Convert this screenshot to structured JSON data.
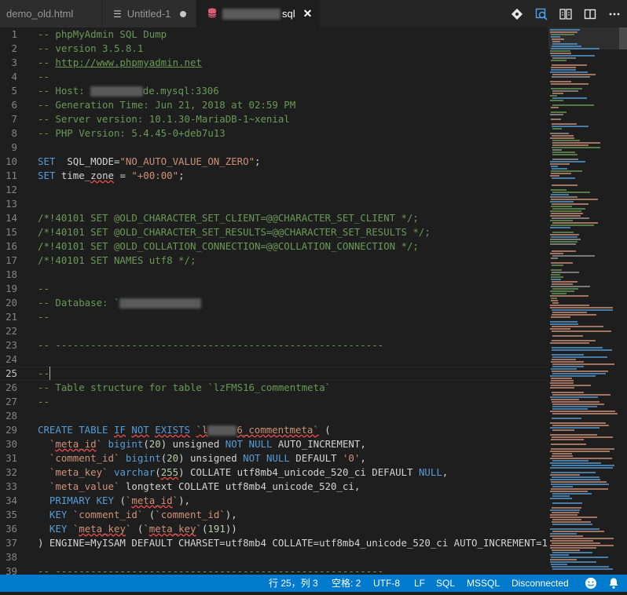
{
  "tabs": [
    {
      "label": "demo_old.html",
      "state": "inactive"
    },
    {
      "label": "Untitled-1",
      "state": "inactive",
      "icon": "menu-lines-icon",
      "dirty": true
    },
    {
      "label": "sql",
      "state": "active",
      "icon": "database-icon",
      "close": "✕"
    }
  ],
  "actions": [
    "git-commit-icon",
    "open-changes-icon",
    "compare-icon",
    "split-editor-icon",
    "more-actions-icon"
  ],
  "lines": [
    {
      "n": "1",
      "t": [
        [
          "cm",
          "-- phpMyAdmin SQL Dump"
        ]
      ]
    },
    {
      "n": "2",
      "t": [
        [
          "cm",
          "-- version 3.5.8.1"
        ]
      ]
    },
    {
      "n": "3",
      "t": [
        [
          "cm",
          "-- "
        ],
        [
          "cm ul",
          "http://www.phpmyadmin.net"
        ]
      ]
    },
    {
      "n": "4",
      "t": [
        [
          "cm",
          "--"
        ]
      ]
    },
    {
      "n": "5",
      "t": [
        [
          "cm",
          "-- Host: "
        ],
        [
          "blur",
          "         "
        ],
        [
          "cm",
          "de.mysql:3306"
        ]
      ]
    },
    {
      "n": "6",
      "t": [
        [
          "cm",
          "-- Generation Time: Jun 21, 2018 at 02:59 PM"
        ]
      ]
    },
    {
      "n": "7",
      "t": [
        [
          "cm",
          "-- Server version: 10.1.30-MariaDB-1~xenial"
        ]
      ]
    },
    {
      "n": "8",
      "t": [
        [
          "cm",
          "-- PHP Version: 5.4.45-0+deb7u13"
        ]
      ]
    },
    {
      "n": "9",
      "t": []
    },
    {
      "n": "10",
      "t": [
        [
          "kw",
          "SET"
        ],
        [
          "",
          "  SQL_MODE="
        ],
        [
          "st",
          "\"NO_AUTO_VALUE_ON_ZERO\""
        ],
        [
          "",
          ";"
        ]
      ]
    },
    {
      "n": "11",
      "t": [
        [
          "kw",
          "SET"
        ],
        [
          "",
          " time_"
        ],
        [
          "sq",
          "zone"
        ],
        [
          "",
          " = "
        ],
        [
          "st",
          "\"+00:00\""
        ],
        [
          "",
          ";"
        ]
      ]
    },
    {
      "n": "12",
      "t": []
    },
    {
      "n": "13",
      "t": []
    },
    {
      "n": "14",
      "t": [
        [
          "cm",
          "/*!40101 SET @OLD_CHARACTER_SET_CLIENT=@@CHARACTER_SET_CLIENT */;"
        ]
      ]
    },
    {
      "n": "15",
      "t": [
        [
          "cm",
          "/*!40101 SET @OLD_CHARACTER_SET_RESULTS=@@CHARACTER_SET_RESULTS */;"
        ]
      ]
    },
    {
      "n": "16",
      "t": [
        [
          "cm",
          "/*!40101 SET @OLD_COLLATION_CONNECTION=@@COLLATION_CONNECTION */;"
        ]
      ]
    },
    {
      "n": "17",
      "t": [
        [
          "cm",
          "/*!40101 SET NAMES utf8 */;"
        ]
      ]
    },
    {
      "n": "18",
      "t": []
    },
    {
      "n": "19",
      "t": [
        [
          "cm",
          "--"
        ]
      ]
    },
    {
      "n": "20",
      "t": [
        [
          "cm",
          "-- Database: `"
        ],
        [
          "blur",
          "              "
        ]
      ]
    },
    {
      "n": "21",
      "t": [
        [
          "cm",
          "--"
        ]
      ]
    },
    {
      "n": "22",
      "t": []
    },
    {
      "n": "23",
      "t": [
        [
          "cm",
          "-- --------------------------------------------------------"
        ]
      ]
    },
    {
      "n": "24",
      "t": []
    },
    {
      "n": "25",
      "t": [
        [
          "cm",
          "--"
        ],
        [
          "cursor",
          ""
        ]
      ],
      "current": true
    },
    {
      "n": "26",
      "t": [
        [
          "cm",
          "-- Table structure for table `lzFMS16_commentmeta`"
        ]
      ]
    },
    {
      "n": "27",
      "t": [
        [
          "cm",
          "--"
        ]
      ]
    },
    {
      "n": "28",
      "t": []
    },
    {
      "n": "29",
      "t": [
        [
          "kw",
          "CREATE TABLE"
        ],
        [
          "",
          " "
        ],
        [
          "kw sq",
          "IF"
        ],
        [
          "",
          " "
        ],
        [
          "kw sq",
          "NOT"
        ],
        [
          "",
          " "
        ],
        [
          "kw sq",
          "EXISTS"
        ],
        [
          "",
          " "
        ],
        [
          "st sq",
          "`l"
        ],
        [
          "blur",
          "     "
        ],
        [
          "st sq",
          "6_commentmeta`"
        ],
        [
          "",
          " ("
        ]
      ]
    },
    {
      "n": "30",
      "t": [
        [
          "",
          "  "
        ],
        [
          "st",
          "`"
        ],
        [
          "st sq",
          "meta_id"
        ],
        [
          "st",
          "`"
        ],
        [
          "",
          " "
        ],
        [
          "kw",
          "bigint"
        ],
        [
          "",
          "("
        ],
        [
          "nm",
          "20"
        ],
        [
          "",
          ") unsigned "
        ],
        [
          "kw",
          "NOT NULL"
        ],
        [
          "",
          " AUTO_INCREMENT,"
        ]
      ]
    },
    {
      "n": "31",
      "t": [
        [
          "",
          "  "
        ],
        [
          "st",
          "`comment_id`"
        ],
        [
          "",
          " "
        ],
        [
          "kw",
          "bigint"
        ],
        [
          "",
          "("
        ],
        [
          "nm",
          "20"
        ],
        [
          "",
          ") unsigned "
        ],
        [
          "kw",
          "NOT NULL"
        ],
        [
          "",
          " DEFAULT "
        ],
        [
          "st",
          "'0'"
        ],
        [
          "",
          ","
        ]
      ]
    },
    {
      "n": "32",
      "t": [
        [
          "",
          "  "
        ],
        [
          "st",
          "`meta_key`"
        ],
        [
          "",
          " "
        ],
        [
          "kw",
          "varchar"
        ],
        [
          "",
          "("
        ],
        [
          "nm sq",
          "255"
        ],
        [
          "",
          ") COLLATE utf8mb4_unicode_520_ci DEFAULT "
        ],
        [
          "kw",
          "NULL"
        ],
        [
          "",
          ","
        ]
      ]
    },
    {
      "n": "33",
      "t": [
        [
          "",
          "  "
        ],
        [
          "st",
          "`meta_value`"
        ],
        [
          "",
          " longtext COLLATE utf8mb4_unicode_520_ci,"
        ]
      ]
    },
    {
      "n": "34",
      "t": [
        [
          "",
          "  "
        ],
        [
          "kw",
          "PRIMARY KEY"
        ],
        [
          "",
          " ("
        ],
        [
          "st",
          "`"
        ],
        [
          "st sq",
          "meta_id"
        ],
        [
          "st",
          "`"
        ],
        [
          "",
          "),"
        ]
      ]
    },
    {
      "n": "35",
      "t": [
        [
          "",
          "  "
        ],
        [
          "kw",
          "KEY"
        ],
        [
          "",
          " "
        ],
        [
          "st",
          "`comment_id`"
        ],
        [
          "",
          " ("
        ],
        [
          "st",
          "`comment_id`"
        ],
        [
          "",
          "),"
        ]
      ]
    },
    {
      "n": "36",
      "t": [
        [
          "",
          "  "
        ],
        [
          "kw",
          "KEY"
        ],
        [
          "",
          " "
        ],
        [
          "st",
          "`"
        ],
        [
          "st sq",
          "meta_key"
        ],
        [
          "st",
          "`"
        ],
        [
          "",
          " ("
        ],
        [
          "st",
          "`"
        ],
        [
          "st sq",
          "meta_key"
        ],
        [
          "st",
          "`"
        ],
        [
          "",
          "("
        ],
        [
          "nm",
          "191"
        ],
        [
          "",
          "))"
        ]
      ]
    },
    {
      "n": "37",
      "t": [
        [
          "",
          ") ENGINE=MyISAM DEFAULT CHARSET=utf8mb4 COLLATE=utf8mb4_unicode_520_ci AUTO_INCREMENT=1 ;"
        ]
      ]
    },
    {
      "n": "38",
      "t": []
    },
    {
      "n": "39",
      "t": [
        [
          "cm",
          "-- --------------------------------------------------------"
        ]
      ]
    }
  ],
  "status": {
    "position": "行 25，列 3",
    "indent": "空格: 2",
    "encoding": "UTF-8",
    "eol": "LF",
    "language": "SQL",
    "connection_type": "MSSQL",
    "connection_state": "Disconnected"
  },
  "colors": {
    "editor_bg": "#1e1e1e",
    "comment": "#6a9955",
    "keyword": "#569cd6",
    "string": "#ce9178",
    "number": "#b5cea8",
    "statusbar": "#007acc",
    "active_tab_icon": "#e05c7b"
  }
}
